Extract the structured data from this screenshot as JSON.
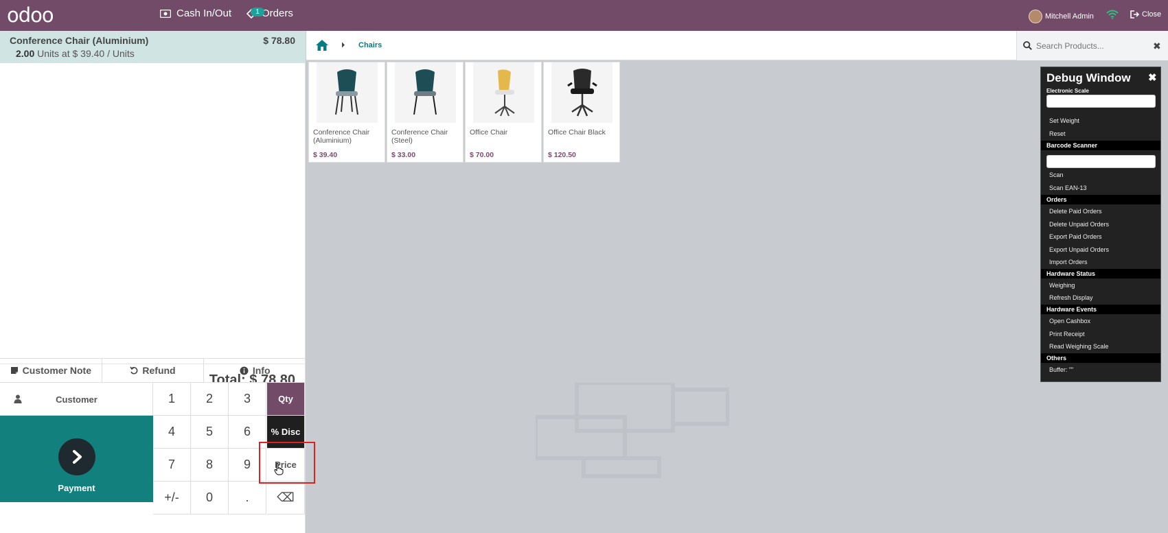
{
  "navbar": {
    "logo": "odoo",
    "cash_label": "Cash In/Out",
    "orders_label": "Orders",
    "orders_badge": "1",
    "user_name": "Mitchell Admin",
    "close_label": "Close",
    "colors": {
      "bar": "#714b67",
      "badge": "#1aa39a",
      "wifi": "#2ec27e"
    }
  },
  "order": {
    "line_name": "Conference Chair (Aluminium)",
    "line_price": "$ 78.80",
    "line_qty": "2.00",
    "line_detail": "Units at $ 39.40 / Units",
    "total_label": "Total: $ 78.80"
  },
  "controls": {
    "customer_note": "Customer Note",
    "refund": "Refund",
    "info": "Info",
    "customer": "Customer",
    "payment": "Payment"
  },
  "numpad": {
    "k1": "1",
    "k2": "2",
    "k3": "3",
    "qty": "Qty",
    "k4": "4",
    "k5": "5",
    "k6": "6",
    "disc": "% Disc",
    "k7": "7",
    "k8": "8",
    "k9": "9",
    "price": "Price",
    "plusminus": "+/-",
    "k0": "0",
    "dot": ".",
    "backspace": "⌫"
  },
  "breadcrumb": {
    "category": "Chairs"
  },
  "search": {
    "placeholder": "Search Products..."
  },
  "products": [
    {
      "name": "Conference Chair (Aluminium)",
      "price": "$ 39.40"
    },
    {
      "name": "Conference Chair (Steel)",
      "price": "$ 33.00"
    },
    {
      "name": "Office Chair",
      "price": "$ 70.00"
    },
    {
      "name": "Office Chair Black",
      "price": "$ 120.50"
    }
  ],
  "debug": {
    "title": "Debug Window",
    "close": "✖",
    "scale_section": "Electronic Scale",
    "set_weight": "Set Weight",
    "reset": "Reset",
    "barcode_section": "Barcode Scanner",
    "scan": "Scan",
    "scan_ean": "Scan EAN-13",
    "orders_section": "Orders",
    "delete_paid": "Delete Paid Orders",
    "delete_unpaid": "Delete Unpaid Orders",
    "export_paid": "Export Paid Orders",
    "export_unpaid": "Export Unpaid Orders",
    "import_orders": "Import Orders",
    "hw_status_section": "Hardware Status",
    "weighing": "Weighing",
    "refresh_display": "Refresh Display",
    "hw_events_section": "Hardware Events",
    "open_cashbox": "Open Cashbox",
    "print_receipt": "Print Receipt",
    "read_scale": "Read Weighing Scale",
    "others_section": "Others",
    "buffer": "Buffer: \"\""
  }
}
